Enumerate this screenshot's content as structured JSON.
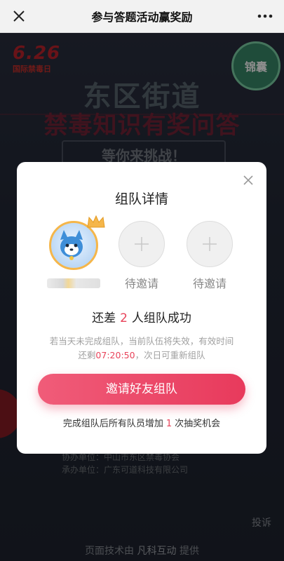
{
  "topbar": {
    "title": "参与答题活动赢奖励",
    "close_icon": "close-icon",
    "more_icon": "more-icon"
  },
  "poster": {
    "badge_date": "6.26",
    "badge_sub": "国际禁毒日",
    "circle_badge": "锦囊",
    "headline1": "东区街道",
    "headline2": "禁毒知识有奖问答",
    "headline3": "等你来挑战！",
    "co_organizer": "协办单位：中山市东区禁毒协会",
    "undertaker": "承办单位：广东可道科技有限公司",
    "complain": "投诉",
    "provided_prefix": "页面技术由",
    "provided_brand": "凡科互动",
    "provided_suffix": "提供"
  },
  "modal": {
    "title": "组队详情",
    "members": [
      {
        "state": "joined",
        "label": ""
      },
      {
        "state": "pending",
        "label": "待邀请"
      },
      {
        "state": "pending",
        "label": "待邀请"
      }
    ],
    "remain_prefix": "还差",
    "remain_count": "2",
    "remain_suffix": "人组队成功",
    "hint_line1": "若当天未完成组队，当前队伍将失效，有效时间",
    "hint_line2_prefix": "还剩",
    "hint_timer": "07:20:50",
    "hint_line2_suffix": "，次日可重新组队",
    "invite_button": "邀请好友组队",
    "bonus_prefix": "完成组队后所有队员增加",
    "bonus_count": "1",
    "bonus_suffix": "次抽奖机会"
  },
  "colors": {
    "accent": "#e8435a",
    "button_start": "#f05c79",
    "button_end": "#e83a5c"
  }
}
